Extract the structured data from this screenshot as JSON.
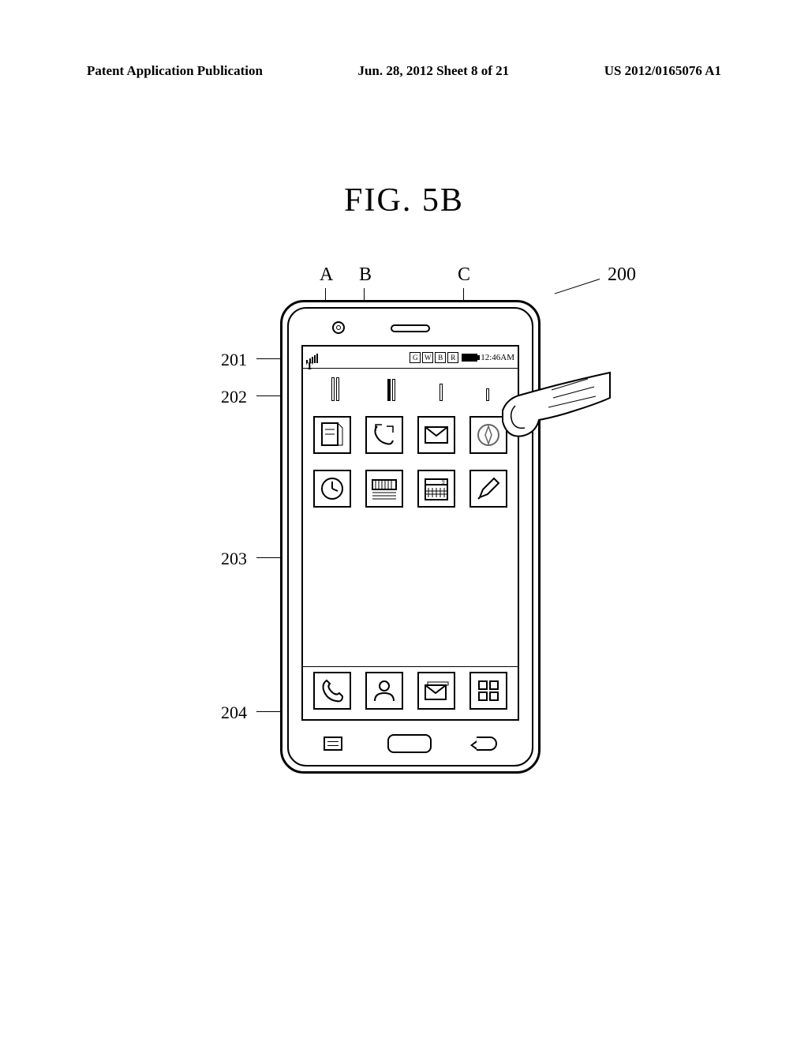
{
  "header": {
    "left": "Patent Application Publication",
    "center": "Jun. 28, 2012  Sheet 8 of 21",
    "right": "US 2012/0165076 A1"
  },
  "figure_label": "FIG.  5B",
  "callouts": {
    "A": "A",
    "B": "B",
    "C": "C",
    "r200": "200",
    "r201": "201",
    "r202": "202",
    "r203": "203",
    "r204": "204"
  },
  "status": {
    "time": "12:46AM",
    "icons": [
      "G",
      "W",
      "B",
      "R"
    ]
  },
  "apps_row1": [
    "notepad",
    "calls",
    "mail",
    "compass"
  ],
  "apps_row2": [
    "clock",
    "keyboard",
    "calendar",
    "pencil"
  ],
  "dock": [
    "phone",
    "contacts",
    "messages",
    "apps"
  ]
}
